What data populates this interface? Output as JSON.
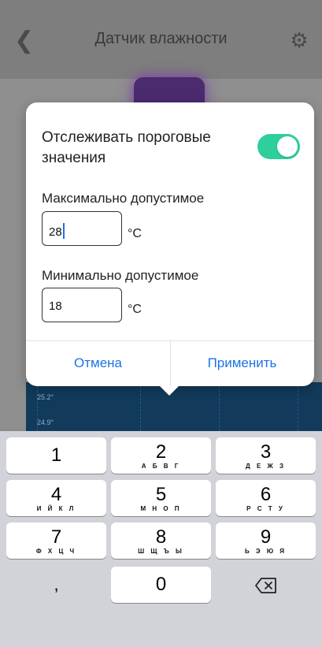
{
  "header": {
    "title": "Датчик влажности",
    "back_icon": "chevron-left-icon",
    "settings_icon": "gear-icon"
  },
  "chart": {
    "ticks": [
      "25.2°",
      "24.9°"
    ]
  },
  "dialog": {
    "track_label": "Отслеживать пороговые значения",
    "track_enabled": true,
    "max_label": "Максимально допустимое",
    "max_value": "28",
    "min_label": "Минимально допустимое",
    "min_value": "18",
    "unit": "°С",
    "cancel_label": "Отмена",
    "apply_label": "Применить",
    "accent_color": "#1a73e8",
    "toggle_color": "#2ecf9c"
  },
  "keyboard": {
    "keys": [
      {
        "num": "1",
        "letters": ""
      },
      {
        "num": "2",
        "letters": "А Б В Г"
      },
      {
        "num": "3",
        "letters": "Д Е Ж З"
      },
      {
        "num": "4",
        "letters": "И Й К Л"
      },
      {
        "num": "5",
        "letters": "М Н О П"
      },
      {
        "num": "6",
        "letters": "Р С Т У"
      },
      {
        "num": "7",
        "letters": "Ф Х Ц Ч"
      },
      {
        "num": "8",
        "letters": "Ш Щ Ъ Ы"
      },
      {
        "num": "9",
        "letters": "Ь Э Ю Я"
      }
    ],
    "comma": ",",
    "zero": "0",
    "delete_icon": "backspace-icon"
  }
}
